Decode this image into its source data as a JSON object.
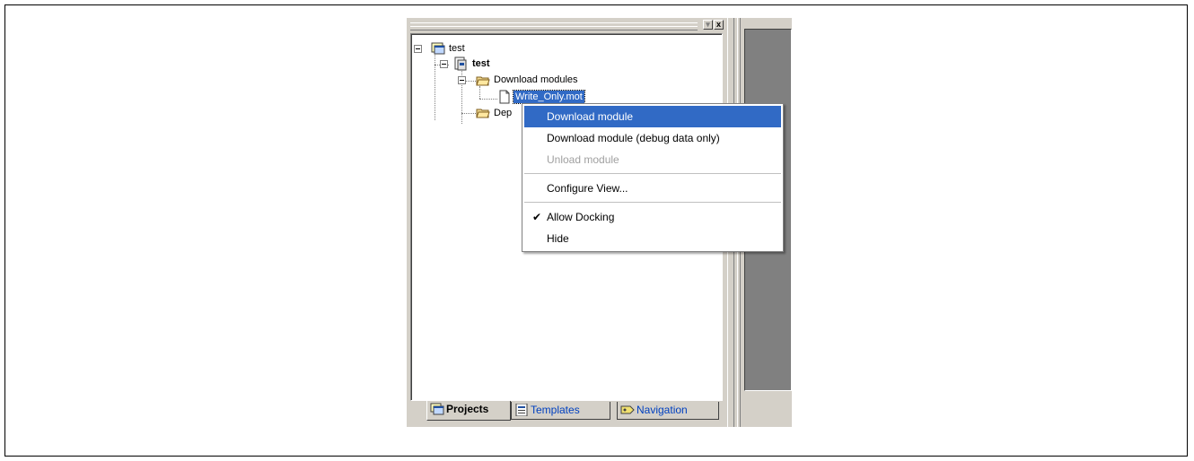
{
  "tree": {
    "root_label": "test",
    "project_label": "test",
    "folder_download": "Download modules",
    "file_write_only": "Write_Only.mot",
    "folder_dep_partial": "Dep"
  },
  "dock_buttons": {
    "dropdown_glyph": "▾",
    "close_glyph": "x"
  },
  "tabs": [
    {
      "label": "Projects",
      "icon": "projects-icon",
      "state": "active"
    },
    {
      "label": "Templates",
      "icon": "templates-icon",
      "state": "inactive"
    },
    {
      "label": "Navigation",
      "icon": "navigation-icon",
      "state": "inactive"
    }
  ],
  "context_menu": {
    "items": [
      {
        "label": "Download module",
        "state": "highlighted"
      },
      {
        "label": "Download module (debug data only)",
        "state": "normal"
      },
      {
        "label": "Unload module",
        "state": "disabled"
      },
      {
        "label": "Configure View...",
        "state": "normal"
      },
      {
        "label": "Allow Docking",
        "state": "checked",
        "check_glyph": "✔"
      },
      {
        "label": "Hide",
        "state": "normal"
      }
    ]
  },
  "colors": {
    "selection": "#316ac5",
    "chrome": "#d4d0c8",
    "dark_pane": "#808080",
    "tab_link": "#0040c0"
  }
}
